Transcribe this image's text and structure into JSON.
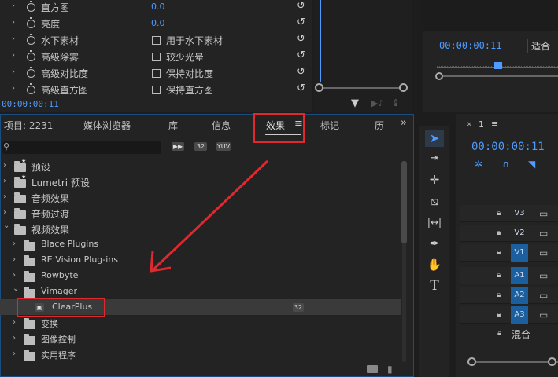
{
  "effect_controls": {
    "rows": [
      {
        "label": "直方图",
        "value": "0.0",
        "checkbox": "",
        "has_stopwatch": true
      },
      {
        "label": "亮度",
        "value": "0.0",
        "checkbox": "",
        "has_stopwatch": true
      },
      {
        "label": "水下素材",
        "value": "",
        "checkbox": "用于水下素材",
        "has_stopwatch": true
      },
      {
        "label": "高级除雾",
        "value": "",
        "checkbox": "较少光晕",
        "has_stopwatch": true
      },
      {
        "label": "高级对比度",
        "value": "",
        "checkbox": "保持对比度",
        "has_stopwatch": true
      },
      {
        "label": "高级直方图",
        "value": "",
        "checkbox": "保持直方图",
        "has_stopwatch": true
      }
    ],
    "timecode": "00:00:00:11"
  },
  "program_monitor": {
    "timecode": "00:00:00:11",
    "fit_label": "适合"
  },
  "project_panel": {
    "tabs": [
      {
        "label": "项目: 2231"
      },
      {
        "label": "媒体浏览器"
      },
      {
        "label": "库"
      },
      {
        "label": "信息"
      },
      {
        "label": "效果"
      },
      {
        "label": "标记"
      },
      {
        "label": "历"
      }
    ],
    "active_tab": "效果",
    "search_placeholder": "",
    "filter_badges": [
      "32",
      "YUV"
    ],
    "tree": [
      {
        "label": "预设",
        "indent": 0,
        "expanded": false,
        "icon": "preset-folder-icon"
      },
      {
        "label": "Lumetri 预设",
        "indent": 0,
        "expanded": false,
        "icon": "preset-folder-icon"
      },
      {
        "label": "音频效果",
        "indent": 0,
        "expanded": false,
        "icon": "folder-icon"
      },
      {
        "label": "音频过渡",
        "indent": 0,
        "expanded": false,
        "icon": "folder-icon"
      },
      {
        "label": "视频效果",
        "indent": 0,
        "expanded": true,
        "icon": "folder-icon"
      },
      {
        "label": "Blace Plugins",
        "indent": 1,
        "expanded": false,
        "icon": "folder-icon"
      },
      {
        "label": "RE:Vision Plug-ins",
        "indent": 1,
        "expanded": false,
        "icon": "folder-icon"
      },
      {
        "label": "Rowbyte",
        "indent": 1,
        "expanded": false,
        "icon": "folder-icon"
      },
      {
        "label": "Vimager",
        "indent": 1,
        "expanded": true,
        "icon": "folder-icon"
      },
      {
        "label": "ClearPlus",
        "indent": 2,
        "expanded": false,
        "icon": "effect-icon",
        "selected": true,
        "badge": "32"
      },
      {
        "label": "变换",
        "indent": 1,
        "expanded": false,
        "icon": "folder-icon"
      },
      {
        "label": "图像控制",
        "indent": 1,
        "expanded": false,
        "icon": "folder-icon"
      },
      {
        "label": "实用程序",
        "indent": 1,
        "expanded": false,
        "icon": "folder-icon"
      }
    ]
  },
  "timeline": {
    "sequence_label": "1",
    "timecode": "00:00:00:11",
    "tracks": [
      {
        "name": "V3",
        "on": false
      },
      {
        "name": "V2",
        "on": false
      },
      {
        "name": "V1",
        "on": true
      },
      {
        "name": "A1",
        "on": true
      },
      {
        "name": "A2",
        "on": true
      },
      {
        "name": "A3",
        "on": true
      }
    ],
    "mix_label": "混合"
  },
  "colors": {
    "accent": "#4f9bff",
    "annotation": "#e0282e",
    "track_on": "#1c5f9e"
  }
}
